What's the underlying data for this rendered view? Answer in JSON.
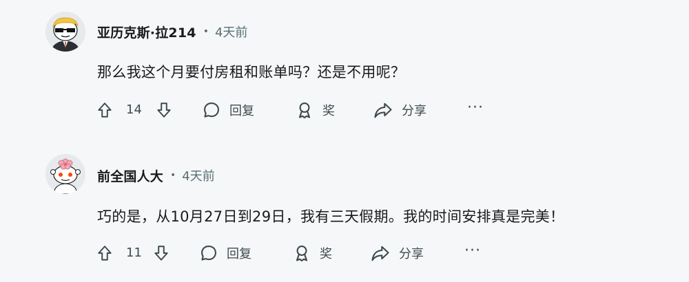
{
  "comments": [
    {
      "author": "亚历克斯·拉214",
      "separator": "•",
      "time": "4天前",
      "text": "那么我这个月要付房租和账单吗？还是不用呢？",
      "score": "14",
      "reply_label": "回复",
      "award_label": "奖",
      "share_label": "分享",
      "more_label": "···"
    },
    {
      "author": "前全国人大",
      "separator": "•",
      "time": "4天前",
      "text": "巧的是，从10月27日到29日，我有三天假期。我的时间安排真是完美！",
      "score": "11",
      "reply_label": "回复",
      "award_label": "奖",
      "share_label": "分享",
      "more_label": "···"
    }
  ]
}
